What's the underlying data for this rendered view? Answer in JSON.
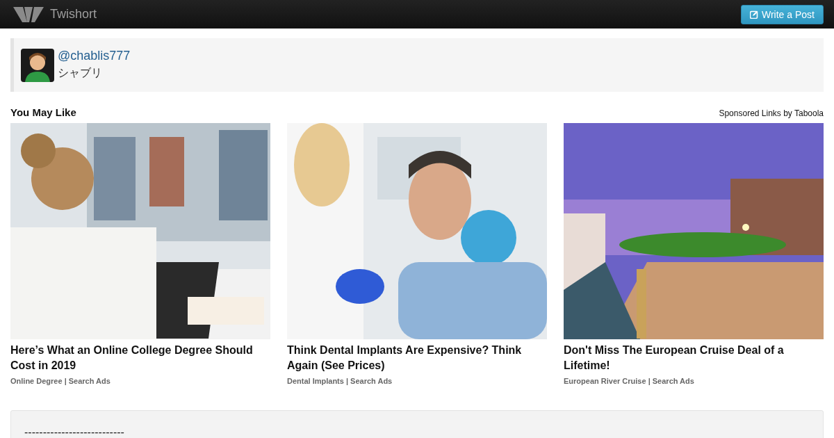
{
  "navbar": {
    "brand": "Twishort",
    "write_button": "Write a Post"
  },
  "author": {
    "handle": "@chablis777",
    "name": "シャブリ"
  },
  "recommendations": {
    "title": "You May Like",
    "sponsor": "Sponsored Links by Taboola",
    "items": [
      {
        "headline": "Here’s What an Online College Degree Should Cost in 2019",
        "source": "Online Degree | Search Ads"
      },
      {
        "headline": "Think Dental Implants Are Expensive? Think Again (See Prices)",
        "source": "Dental Implants | Search Ads"
      },
      {
        "headline": "Don't Miss The European Cruise Deal of a Lifetime!",
        "source": "European River Cruise | Search Ads"
      }
    ]
  },
  "post": {
    "text": "---------------------------"
  }
}
